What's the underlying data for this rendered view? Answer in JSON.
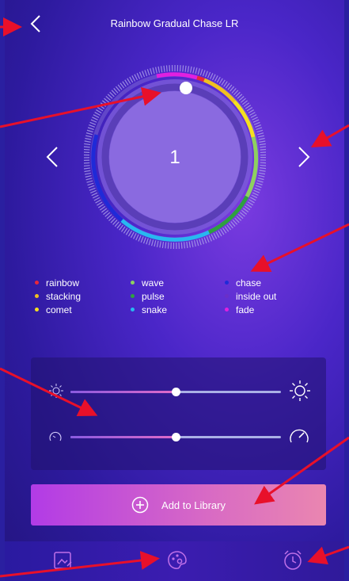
{
  "header": {
    "title": "Rainbow Gradual Chase LR"
  },
  "dial": {
    "value": "1"
  },
  "legend": {
    "col1": [
      {
        "label": "rainbow",
        "color": "#e8283a"
      },
      {
        "label": "stacking",
        "color": "#f0c020"
      },
      {
        "label": "comet",
        "color": "#f5e020"
      }
    ],
    "col2": [
      {
        "label": "wave",
        "color": "#8ed060"
      },
      {
        "label": "pulse",
        "color": "#2ea040"
      },
      {
        "label": "snake",
        "color": "#28b8f0"
      }
    ],
    "col3": [
      {
        "label": "chase",
        "color": "#1f2ad8"
      },
      {
        "label": "inside out",
        "color": "#6a2fc8"
      },
      {
        "label": "fade",
        "color": "#e020e0"
      }
    ]
  },
  "sliders": {
    "brightness": {
      "value_percent": 50
    },
    "speed": {
      "value_percent": 50
    }
  },
  "add_button": {
    "label": "Add to Library"
  },
  "colors": {
    "accent": "#b23be6",
    "annotation": "#e8102a"
  }
}
